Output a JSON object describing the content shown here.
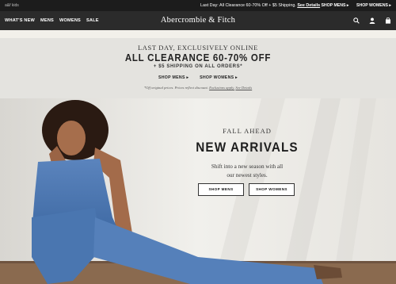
{
  "topbar": {
    "kids_label": "a&f kids",
    "promo_text": "Last Day: All Clearance 60-70% Off + $5 Shipping.",
    "promo_link": "See Details",
    "shop_mens": "SHOP MENS ▸",
    "shop_womens": "SHOP WOMENS ▸"
  },
  "nav": {
    "items": [
      "WHAT'S NEW",
      "MENS",
      "WOMENS",
      "SALE"
    ],
    "logo": "Abercrombie & Fitch",
    "icons": [
      "search-icon",
      "user-icon",
      "bag-icon"
    ]
  },
  "promo": {
    "eyebrow": "LAST DAY, EXCLUSIVELY ONLINE",
    "headline": "ALL CLEARANCE 60-70% OFF",
    "sub": "+ $5 SHIPPING ON ALL ORDERS*",
    "links": [
      "SHOP MENS ▸",
      "SHOP WOMENS ▸"
    ],
    "fine_print": "*Off original prices. Prices reflect discount.",
    "fine_link_1": "Exclusions apply.",
    "fine_link_2": "See Details"
  },
  "hero": {
    "eyebrow": "FALL AHEAD",
    "title": "NEW ARRIVALS",
    "body_line1": "Shift into a new season with all",
    "body_line2": "our newest styles.",
    "btn_men": "SHOP MENS",
    "btn_women": "SHOP WOMENS"
  },
  "colors": {
    "topbar_bg": "#1c1c1c",
    "nav_bg": "#2b2b2b",
    "promo_bg": "#e4e3df",
    "denim": "#4d78b3"
  }
}
